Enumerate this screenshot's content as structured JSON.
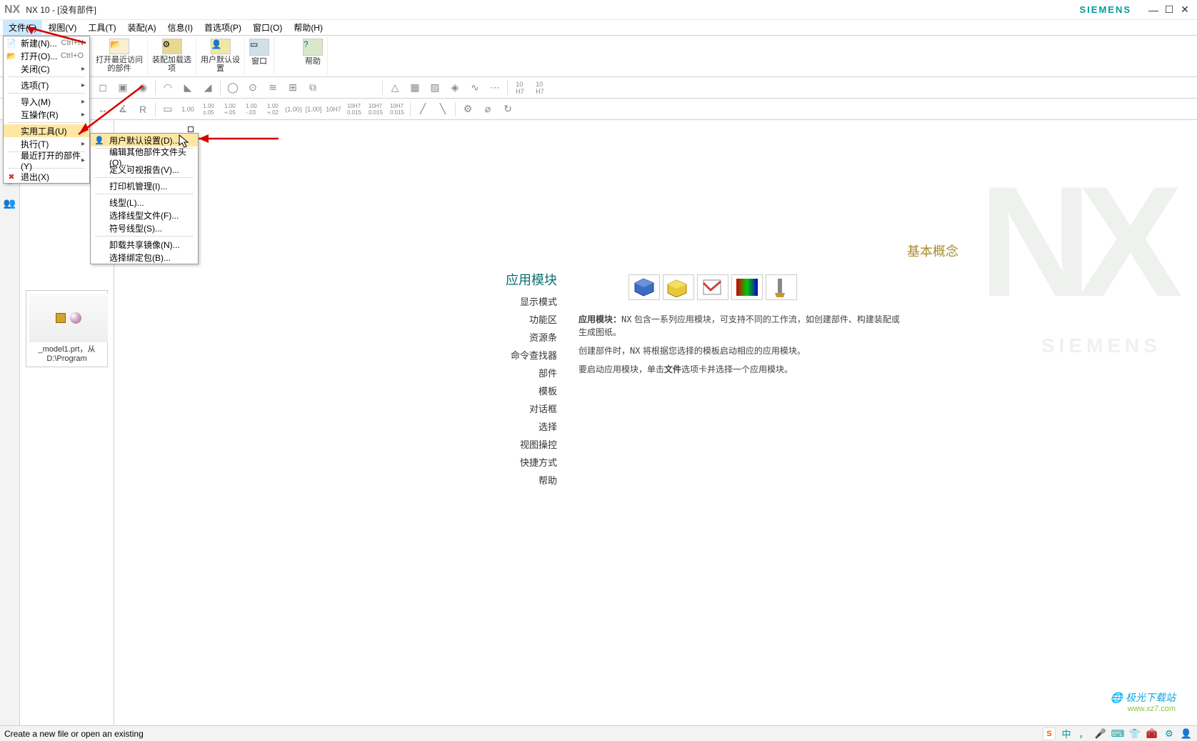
{
  "titlebar": {
    "app": "NX",
    "title": "NX 10 - [没有部件]",
    "brand": "SIEMENS"
  },
  "menubar": [
    "文件(F)",
    "视图(V)",
    "工具(T)",
    "装配(A)",
    "信息(I)",
    "首选项(P)",
    "窗口(O)",
    "帮助(H)"
  ],
  "ribbon": {
    "recent": {
      "label1": "打开最近访问",
      "label2": "的部件"
    },
    "assembly": {
      "label1": "装配加载选",
      "label2": "项"
    },
    "defaults": {
      "label1": "用户默认设",
      "label2": "置"
    },
    "window": "窗口",
    "help": "帮助"
  },
  "file_menu": {
    "new": {
      "label": "新建(N)...",
      "shortcut": "Ctrl+N"
    },
    "open": {
      "label": "打开(O)...",
      "shortcut": "Ctrl+O"
    },
    "close": "关闭(C)",
    "options": "选项(T)",
    "import": "导入(M)",
    "interop": "互操作(R)",
    "utilities": "实用工具(U)",
    "execute": "执行(T)",
    "recent": "最近打开的部件(Y)",
    "exit": "退出(X)"
  },
  "sub_menu": {
    "user_defaults": "用户默认设置(D)...",
    "edit_part_header": "编辑其他部件文件头(O)...",
    "define_visual_report": "定义可视报告(V)...",
    "printer_admin": "打印机管理(I)...",
    "linetype": "线型(L)...",
    "select_linetype_file": "选择线型文件(F)...",
    "symbol_linetype": "符号线型(S)...",
    "unload_shared_image": "卸载共享镜像(N)...",
    "select_bind_pkg": "选择绑定包(B)..."
  },
  "history": {
    "caption1": "_model1.prt，从",
    "caption2": "D:\\Program"
  },
  "welcome": {
    "apps_title": "应用模块",
    "concepts_title": "基本概念",
    "links": [
      "显示模式",
      "功能区",
      "资源条",
      "命令查找器",
      "部件",
      "模板",
      "对话框",
      "选择",
      "视图操控",
      "快捷方式",
      "帮助"
    ],
    "desc1a": "应用模块：",
    "desc1b": "NX 包含一系列应用模块，可支持不同的工作流，如创建部件、构建装配或生成图纸。",
    "desc2a": "创建部件时，",
    "desc2b": "NX 将根据您选择的模板启动相应的应用模块。",
    "desc3a": "要启动应用模块，单击",
    "desc3b": "文件",
    "desc3c": "选项卡并选择一个应用模块。"
  },
  "watermark": {
    "main": "NX",
    "sub": "SIEMENS"
  },
  "status": "Create a new file or open an existing",
  "tray": {
    "cn": "中",
    "separator": "•"
  },
  "logo": {
    "line1": "极光下载站",
    "line2": "www.xz7.com"
  },
  "toolbar2_values": [
    "1.00",
    "1.00",
    "1.00",
    "1.00",
    "1.00",
    "1.00",
    "1.00",
    "10H7",
    "10H7",
    "10H7",
    "10H7"
  ]
}
